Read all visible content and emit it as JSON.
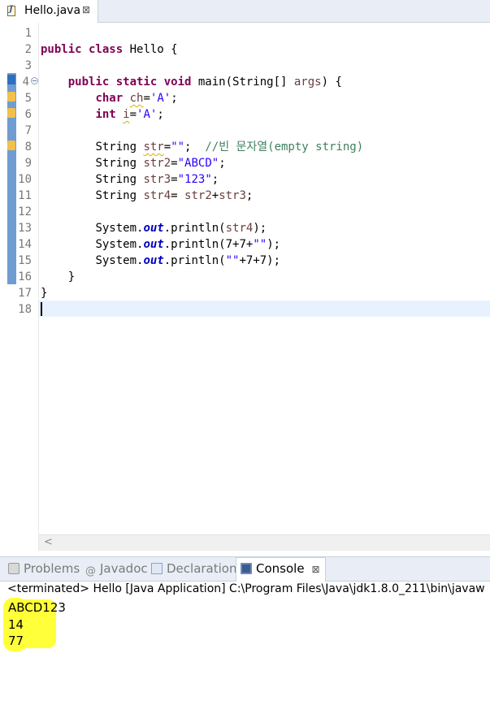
{
  "editor": {
    "tab": {
      "label": "Hello.java",
      "close": "⊠"
    },
    "line_numbers": [
      "1",
      "2",
      "3",
      "4",
      "5",
      "6",
      "7",
      "8",
      "9",
      "10",
      "11",
      "12",
      "13",
      "14",
      "15",
      "16",
      "17",
      "18"
    ],
    "code": {
      "l2": {
        "kw": "public class",
        "rest": " Hello {"
      },
      "l4": {
        "kw": "public static void",
        "rest1": " main(String[] ",
        "param": "args",
        "rest2": ") {"
      },
      "l5": {
        "kw": "char",
        "var": "ch",
        "eq": "=",
        "str": "'A'",
        "end": ";"
      },
      "l6": {
        "kw": "int",
        "var": "i",
        "eq": "=",
        "str": "'A'",
        "end": ";"
      },
      "l8": {
        "type": "String ",
        "var": "str",
        "eq": "=",
        "str": "\"\"",
        "end": ";  ",
        "comment": "//빈 문자열(empty string)"
      },
      "l9": {
        "type": "String ",
        "var": "str2",
        "eq": "=",
        "str": "\"ABCD\"",
        "end": ";"
      },
      "l10": {
        "type": "String ",
        "var": "str3",
        "eq": "=",
        "str": "\"123\"",
        "end": ";"
      },
      "l11": {
        "type": "String ",
        "var": "str4",
        "eq": "= ",
        "v1": "str2",
        "plus": "+",
        "v2": "str3",
        "end": ";"
      },
      "l13": {
        "a": "System.",
        "fld": "out",
        "b": ".println(",
        "v": "str4",
        "c": ");"
      },
      "l14": {
        "a": "System.",
        "fld": "out",
        "b": ".println(7+7+",
        "str": "\"\"",
        "c": ");"
      },
      "l15": {
        "a": "System.",
        "fld": "out",
        "b": ".println(",
        "str": "\"\"",
        "c": "+7+7);"
      },
      "l16": "}",
      "l17": "}"
    },
    "scroll_left": "<"
  },
  "views": {
    "tabs": [
      {
        "label": "Problems"
      },
      {
        "label": "Javadoc",
        "icon": "@"
      },
      {
        "label": "Declaration"
      },
      {
        "label": "Console",
        "close": "⊠"
      }
    ]
  },
  "console": {
    "header": "<terminated> Hello [Java Application] C:\\Program Files\\Java\\jdk1.8.0_211\\bin\\javaw",
    "output": [
      "ABCD123",
      "14",
      "77"
    ]
  },
  "colors": {
    "keyword": "#7f0055",
    "string": "#2a00ff",
    "comment": "#3f7f5f",
    "field": "#0000c0",
    "highlight": "#ffff3a"
  }
}
